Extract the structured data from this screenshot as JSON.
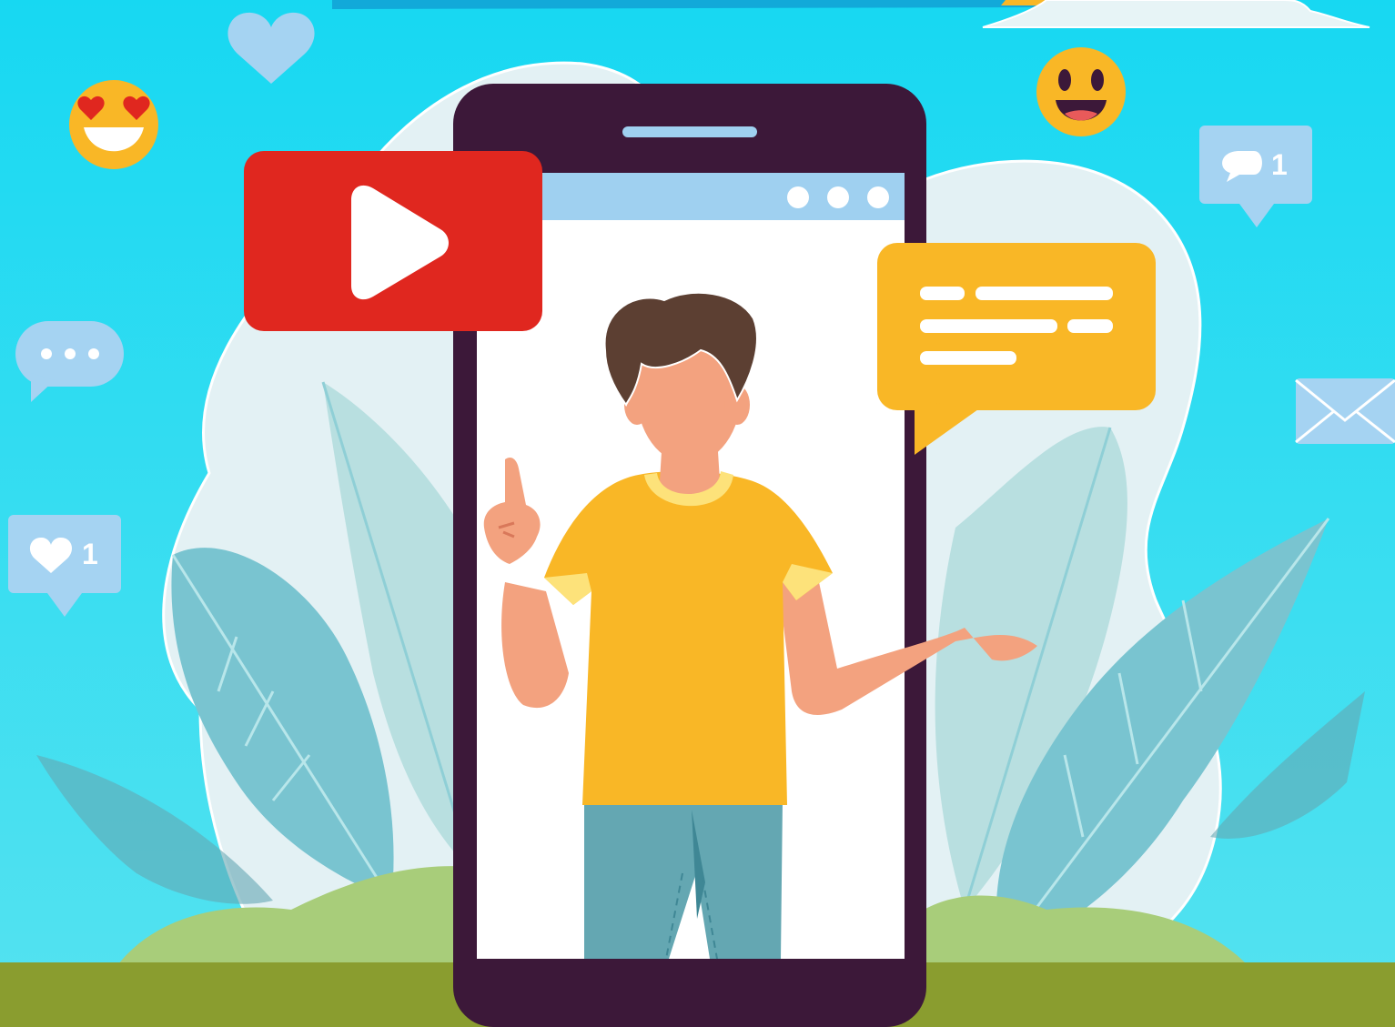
{
  "badges": {
    "like_count": "1",
    "comment_count": "1"
  },
  "colors": {
    "sky_top": "#17d8f2",
    "sky_bottom": "#55e2f0",
    "ground": "#8a9d2f",
    "hill": "#a8cd7a",
    "phone_body": "#3c1839",
    "phone_screen_bar": "#9fd0f0",
    "play_button": "#e0271f",
    "chat_bubble": "#f9b726",
    "badge_blue": "#a5d3f2",
    "shirt": "#f9b726",
    "skin": "#f3a27f",
    "hair": "#5c3f32",
    "pants": "#64a7b2",
    "leaf_blue": "#79c4d0",
    "leaf_pale": "#b8dfe0"
  },
  "icons": [
    "heart-icon",
    "heart-eyes-emoji-icon",
    "grinning-emoji-icon",
    "comment-icon",
    "ellipsis-chat-icon",
    "like-badge-icon",
    "envelope-icon",
    "play-icon",
    "chat-bubble-icon"
  ]
}
